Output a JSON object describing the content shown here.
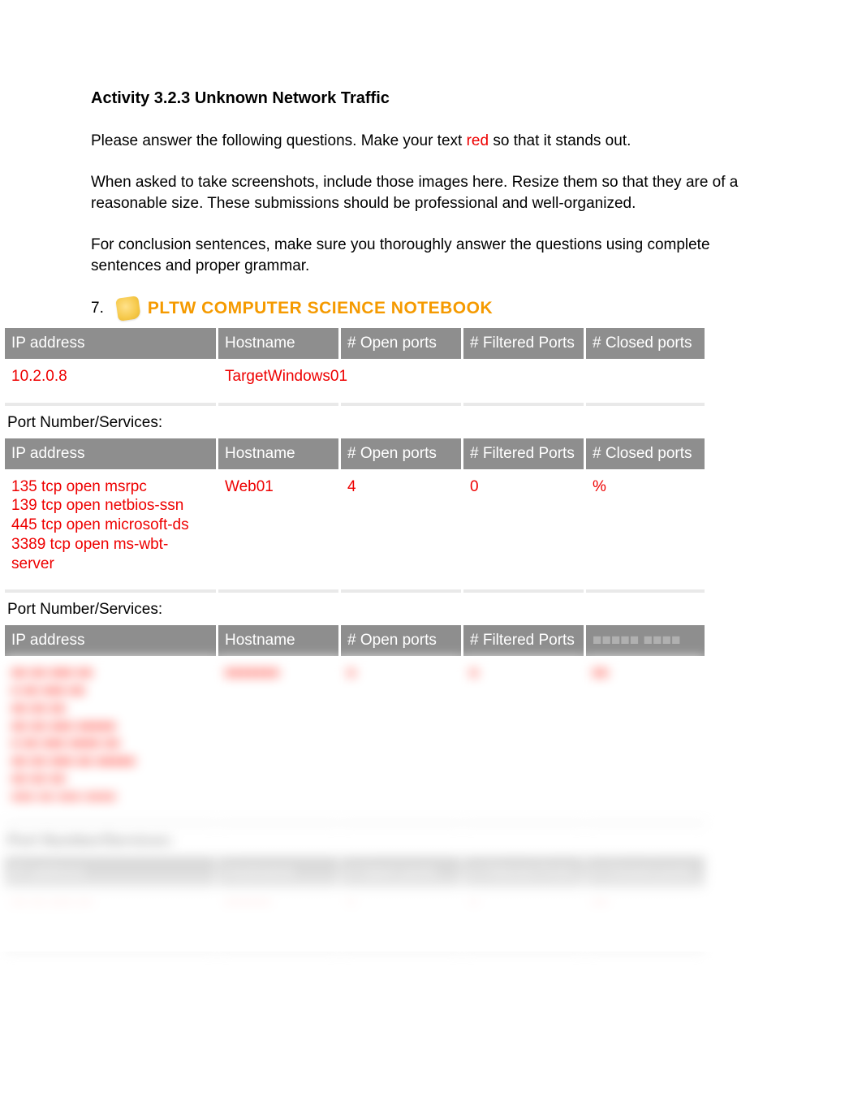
{
  "title": "Activity 3.2.3 Unknown Network Traffic",
  "intro": {
    "p1a": "Please answer the following questions. Make your text ",
    "p1_red": "red",
    "p1b": " so that it stands out.",
    "p2": "When asked to take screenshots, include those images here. Resize them so that they are of a reasonable size. These submissions should be professional and well-organized.",
    "p3": "For conclusion sentences, make sure you thoroughly answer the questions using complete sentences and proper grammar."
  },
  "notebook": {
    "num": "7.",
    "label": "PLTW COMPUTER SCIENCE NOTEBOOK"
  },
  "headers": {
    "ip": "IP address",
    "host": "Hostname",
    "open": "# Open ports",
    "filtered": "# Filtered Ports",
    "closed": "# Closed ports"
  },
  "section_label": "Port Number/Services:",
  "tables": [
    {
      "row": {
        "ip": "10.2.0.8",
        "host": "TargetWindows01",
        "open": "",
        "filtered": "",
        "closed": ""
      }
    },
    {
      "row": {
        "ip": "135 tcp open msrpc\n139 tcp open netbios-ssn\n445 tcp open microsoft-ds\n3389 tcp open ms-wbt-server",
        "host": "Web01",
        "open": "4",
        "filtered": "0",
        "closed": "%"
      }
    },
    {
      "row": {
        "ip": "■■ ■■ ■■■ ■■\n■ ■■ ■■■ ■■\n■■ ■■ ■■\n■■ ■■ ■■■ ■■■■■\n■ ■■ ■■■ ■■■■ ■■\n■■ ■■ ■■■ ■■ ■■■■■\n■■ ■■ ■■\n■■■ ■■ ■■■ ■■■■",
        "host": "■■■■■■■",
        "open": "■",
        "filtered": "■",
        "closed": "■■"
      }
    },
    {
      "row": {
        "ip": "■■ ■■ ■■■ ■■\n■ ■■ ■■■ ■■",
        "host": "■■■■■■",
        "open": "■",
        "filtered": "■",
        "closed": "■■"
      }
    }
  ],
  "blur_headers_hidden": "■■■■■ ■■■■"
}
